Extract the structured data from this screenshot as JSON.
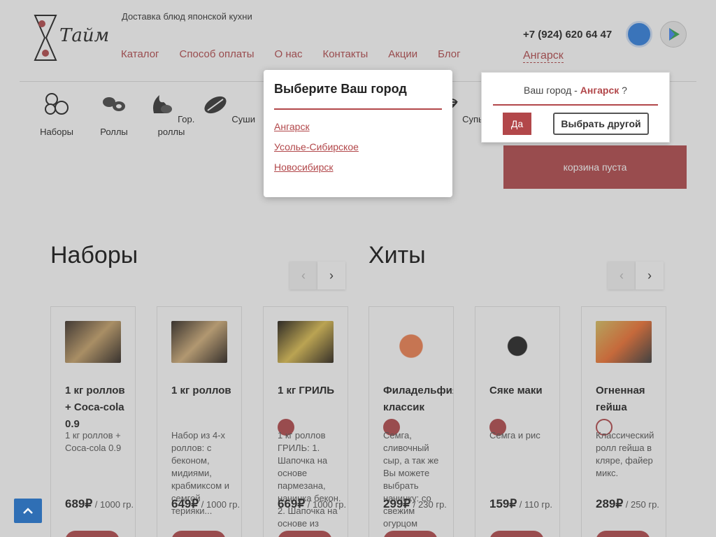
{
  "header": {
    "tagline": "Доставка блюд японской кухни",
    "phone": "+7 (924) 620 64 47",
    "city": "Ангарск",
    "nav": [
      "Каталог",
      "Способ оплаты",
      "О нас",
      "Контакты",
      "Акции",
      "Блог"
    ],
    "logo_text": "Тайм"
  },
  "categories": [
    "Наборы",
    "Роллы",
    "Гор. роллы",
    "Суши",
    "Супы"
  ],
  "cart": {
    "label": "корзина пуста"
  },
  "sections": {
    "sets": {
      "title": "Наборы"
    },
    "hits": {
      "title": "Хиты"
    }
  },
  "products": [
    {
      "title": "1 кг роллов + Coca-cola 0.9",
      "desc": "1 кг роллов + Coca-cola 0.9",
      "price": "689₽",
      "weight": " / 1000 гр."
    },
    {
      "title": "1 кг роллов",
      "desc": "Набор из 4-х роллов: с беконом, мидиями, крабмиксом и семгой терияки...",
      "price": "649₽",
      "weight": " / 1000 гр."
    },
    {
      "title": "1 кг ГРИЛЬ",
      "desc": "1 кг роллов ГРИЛЬ: 1. Шапочка на основе пармезана, начинка бекон. 2. Шапочка на основе из",
      "price": "669₽",
      "weight": " / 1000 гр."
    },
    {
      "title": "Филадельфия классик",
      "desc": "Семга, сливочный сыр, а так же Вы можете выбрать начинку: со свежим огурцом",
      "price": "299₽",
      "weight": " / 230 гр."
    },
    {
      "title": "Сяке маки",
      "desc": "Семга и рис",
      "price": "159₽",
      "weight": " / 110 гр."
    },
    {
      "title": "Огненная гейша",
      "desc": "Классический ролл гейша в кляре, файер микс.",
      "price": "289₽",
      "weight": " / 250 гр."
    }
  ],
  "city_popup": {
    "title": "Выберите Ваш город",
    "cities": [
      "Ангарск",
      "Усолье-Сибирское",
      "Новосибирск"
    ]
  },
  "confirm": {
    "prefix": "Ваш город - ",
    "city": "Ангарск",
    "suffix": " ?",
    "yes": "Да",
    "other": "Выбрать другой"
  },
  "colors": {
    "accent": "#b2474a",
    "to_top": "#2f6fb5"
  }
}
